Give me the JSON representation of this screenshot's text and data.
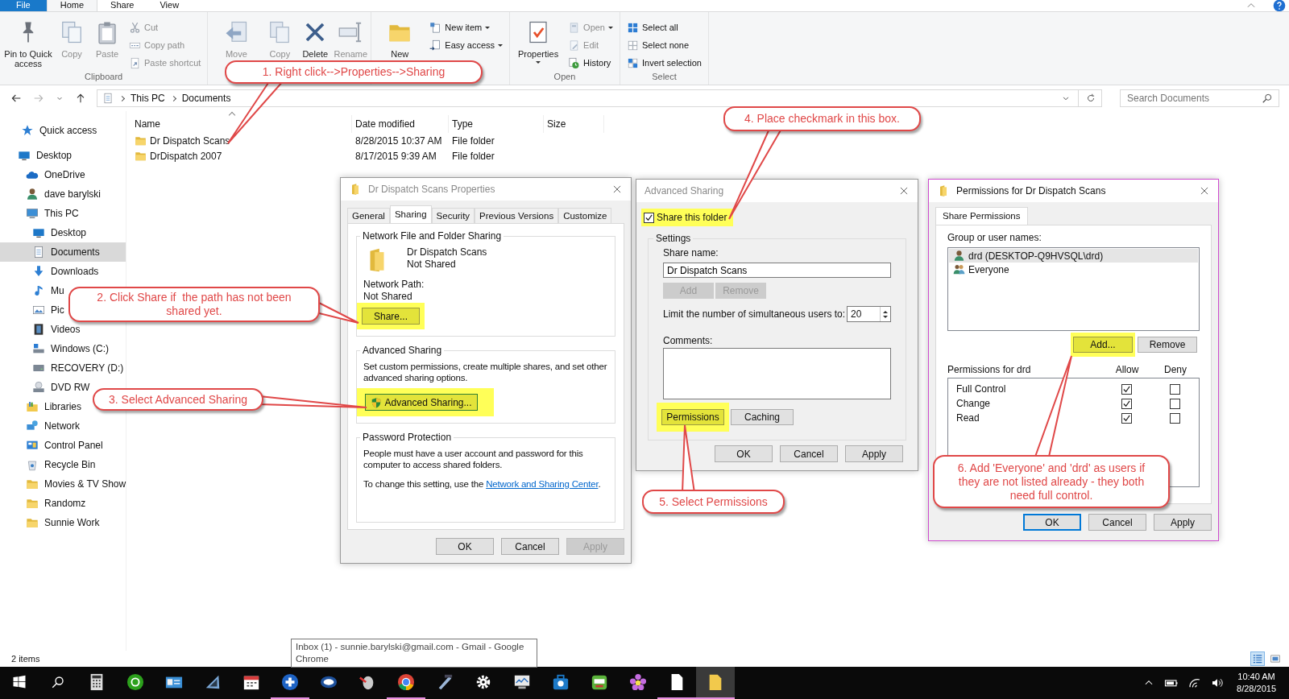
{
  "ribbon_tabs": [
    {
      "label": "File",
      "kind": "file",
      "selected": false
    },
    {
      "label": "Home",
      "kind": "tab",
      "selected": true
    },
    {
      "label": "Share",
      "kind": "tab",
      "selected": false
    },
    {
      "label": "View",
      "kind": "tab",
      "selected": false
    }
  ],
  "ribbon_groups": [
    {
      "label": "Clipboard",
      "large": [
        {
          "label": "Pin to Quick access",
          "disabled": false
        },
        {
          "label": "Copy",
          "disabled": true
        },
        {
          "label": "Paste",
          "disabled": true
        }
      ],
      "small": [
        {
          "label": "Cut",
          "disabled": true,
          "dropdown": false
        },
        {
          "label": "Copy path",
          "disabled": true,
          "dropdown": false
        },
        {
          "label": "Paste shortcut",
          "disabled": true,
          "dropdown": false
        }
      ]
    },
    {
      "large": [
        {
          "label": "Move",
          "disabled": true
        },
        {
          "label": "Copy",
          "disabled": true
        },
        {
          "label": "Delete",
          "disabled": false
        },
        {
          "label": "Rename",
          "disabled": true
        }
      ]
    },
    {
      "large": [
        {
          "label": "New",
          "disabled": false
        }
      ],
      "small": [
        {
          "label": "New item",
          "disabled": false,
          "dropdown": true
        },
        {
          "label": "Easy access",
          "disabled": false,
          "dropdown": true
        }
      ]
    },
    {
      "label": "Open",
      "large": [
        {
          "label": "Properties",
          "disabled": false,
          "dropdown": true
        }
      ],
      "small": [
        {
          "label": "Open",
          "disabled": true,
          "dropdown": true
        },
        {
          "label": "Edit",
          "disabled": true,
          "dropdown": false
        },
        {
          "label": "History",
          "disabled": false,
          "dropdown": false
        }
      ]
    },
    {
      "label": "Select",
      "small": [
        {
          "label": "Select all",
          "disabled": false,
          "dropdown": false
        },
        {
          "label": "Select none",
          "disabled": false,
          "dropdown": false
        },
        {
          "label": "Invert selection",
          "disabled": false,
          "dropdown": false
        }
      ]
    }
  ],
  "address": {
    "crumbs": [
      "This PC",
      "Documents"
    ],
    "search_placeholder": "Search Documents"
  },
  "nav": [
    {
      "label": "Quick access",
      "kind": "star",
      "selected": false
    },
    {
      "label": "Desktop",
      "kind": "desktop",
      "selected": false,
      "children": [
        {
          "label": "OneDrive",
          "kind": "cloud",
          "selected": false
        },
        {
          "label": "dave barylski",
          "kind": "user",
          "selected": false
        },
        {
          "label": "This PC",
          "kind": "pc",
          "selected": false,
          "children": [
            {
              "label": "Desktop",
              "kind": "desktop",
              "selected": false
            },
            {
              "label": "Documents",
              "kind": "documents",
              "selected": true
            },
            {
              "label": "Downloads",
              "kind": "downloads",
              "selected": false
            },
            {
              "label": "Mu",
              "kind": "music",
              "selected": false
            },
            {
              "label": "Pic",
              "kind": "pictures",
              "selected": false
            },
            {
              "label": "Videos",
              "kind": "videos",
              "selected": false
            },
            {
              "label": "Windows (C:)",
              "kind": "system_drive",
              "selected": false
            },
            {
              "label": "RECOVERY (D:)",
              "kind": "drive",
              "selected": false
            },
            {
              "label": "DVD RW",
              "kind": "disc",
              "selected": false
            }
          ]
        },
        {
          "label": "Libraries",
          "kind": "library",
          "selected": false
        },
        {
          "label": "Network",
          "kind": "network",
          "selected": false
        },
        {
          "label": "Control Panel",
          "kind": "panel",
          "selected": false
        },
        {
          "label": "Recycle Bin",
          "kind": "bin",
          "selected": false
        },
        {
          "label": "Movies & TV Show",
          "kind": "folder",
          "selected": false
        },
        {
          "label": "Randomz",
          "kind": "folder",
          "selected": false
        },
        {
          "label": "Sunnie Work",
          "kind": "folder",
          "selected": false
        }
      ]
    }
  ],
  "files": {
    "columns": [
      "Name",
      "Date modified",
      "Type",
      "Size"
    ],
    "rows": [
      {
        "name": "Dr Dispatch Scans",
        "date": "8/28/2015 10:37 AM",
        "type": "File folder"
      },
      {
        "name": "DrDispatch 2007",
        "date": "8/17/2015 9:39 AM",
        "type": "File folder"
      }
    ]
  },
  "status_bar": {
    "count": "2 items",
    "views": [
      {
        "selected": true
      },
      {
        "selected": false
      }
    ]
  },
  "properties_dialog": {
    "title": "Dr Dispatch Scans Properties",
    "active": false,
    "tabs": [
      {
        "label": "General",
        "selected": false
      },
      {
        "label": "Sharing",
        "selected": true
      },
      {
        "label": "Security",
        "selected": false
      },
      {
        "label": "Previous Versions",
        "selected": false
      },
      {
        "label": "Customize",
        "selected": false
      }
    ],
    "network_group": {
      "legend": "Network File and Folder Sharing",
      "folder_name": "Dr Dispatch Scans",
      "folder_state": "Not Shared",
      "path_label": "Network Path:",
      "path_value": "Not Shared",
      "button": {
        "label": "Share...",
        "highlighted": true
      }
    },
    "advanced_group": {
      "legend": "Advanced Sharing",
      "text": "Set custom permissions, create multiple shares, and set other advanced sharing options.",
      "button": {
        "label": "Advanced Sharing...",
        "highlighted": true
      }
    },
    "password_group": {
      "legend": "Password Protection",
      "text": "People must have a user account and password for this computer to access shared folders.",
      "change_text": "To change this setting, use the",
      "link": "Network and Sharing Center",
      "link_end": "."
    },
    "buttons": [
      {
        "label": "OK",
        "disabled": false
      },
      {
        "label": "Cancel",
        "disabled": false
      },
      {
        "label": "Apply",
        "disabled": true
      }
    ]
  },
  "advanced_dialog": {
    "title": "Advanced Sharing",
    "active": false,
    "share_checkbox": {
      "label": "Share this folder",
      "checked": true,
      "highlighted": true
    },
    "legend": "Settings",
    "share_name_label": "Share name:",
    "share_name": "Dr Dispatch Scans",
    "name_buttons": [
      {
        "label": "Add",
        "disabled": true
      },
      {
        "label": "Remove",
        "disabled": true
      }
    ],
    "limit_label": "Limit the number of simultaneous users to:",
    "limit_value": "20",
    "comments_label": "Comments:",
    "option_buttons": [
      {
        "label": "Permissions",
        "highlighted": true
      },
      {
        "label": "Caching",
        "highlighted": false
      }
    ],
    "buttons": [
      {
        "label": "OK",
        "disabled": false
      },
      {
        "label": "Cancel",
        "disabled": false
      },
      {
        "label": "Apply",
        "disabled": false
      }
    ]
  },
  "permissions_dialog": {
    "title": "Permissions for Dr Dispatch Scans",
    "active": true,
    "tab": "Share Permissions",
    "users_label": "Group or user names:",
    "users": [
      {
        "name": "drd (DESKTOP-Q9HVSQL\\drd)",
        "kind": "user",
        "selected": true
      },
      {
        "name": "Everyone",
        "kind": "group",
        "selected": false
      }
    ],
    "user_buttons": [
      {
        "label": "Add...",
        "highlighted": true
      },
      {
        "label": "Remove",
        "highlighted": false
      }
    ],
    "perm_label": "Permissions for drd",
    "allow_label": "Allow",
    "deny_label": "Deny",
    "permissions": [
      {
        "name": "Full Control",
        "allow": true,
        "deny": false
      },
      {
        "name": "Change",
        "allow": true,
        "deny": false
      },
      {
        "name": "Read",
        "allow": true,
        "deny": false
      }
    ],
    "buttons": [
      {
        "label": "OK",
        "default": true
      },
      {
        "label": "Cancel",
        "default": false
      },
      {
        "label": "Apply",
        "default": false
      }
    ]
  },
  "callouts": [
    "1. Right click-->Properties-->Sharing",
    "2. Click Share if  the path has not been shared yet.",
    "3. Select Advanced Sharing",
    "4. Place checkmark in this box.",
    "5. Select Permissions",
    "6. Add 'Everyone' and 'drd' as users if they are not listed already - they both need full control."
  ],
  "tooltip": "Inbox (1) - sunnie.barylski@gmail.com - Gmail - Google Chrome",
  "taskbar": {
    "apps": [
      {
        "running": false,
        "selected": false
      },
      {
        "running": false,
        "selected": false
      },
      {
        "running": false,
        "selected": false
      },
      {
        "running": false,
        "selected": false
      },
      {
        "running": false,
        "selected": false
      },
      {
        "running": true,
        "selected": false
      },
      {
        "running": false,
        "selected": false
      },
      {
        "running": false,
        "selected": false
      },
      {
        "running": true,
        "selected": false
      },
      {
        "running": false,
        "selected": false
      },
      {
        "running": false,
        "selected": false
      },
      {
        "running": false,
        "selected": false
      },
      {
        "running": false,
        "selected": false
      },
      {
        "running": false,
        "selected": false
      },
      {
        "running": false,
        "selected": false
      },
      {
        "running": true,
        "selected": false
      },
      {
        "running": true,
        "selected": true
      }
    ],
    "time": "10:40 AM",
    "date": "8/28/2015"
  }
}
